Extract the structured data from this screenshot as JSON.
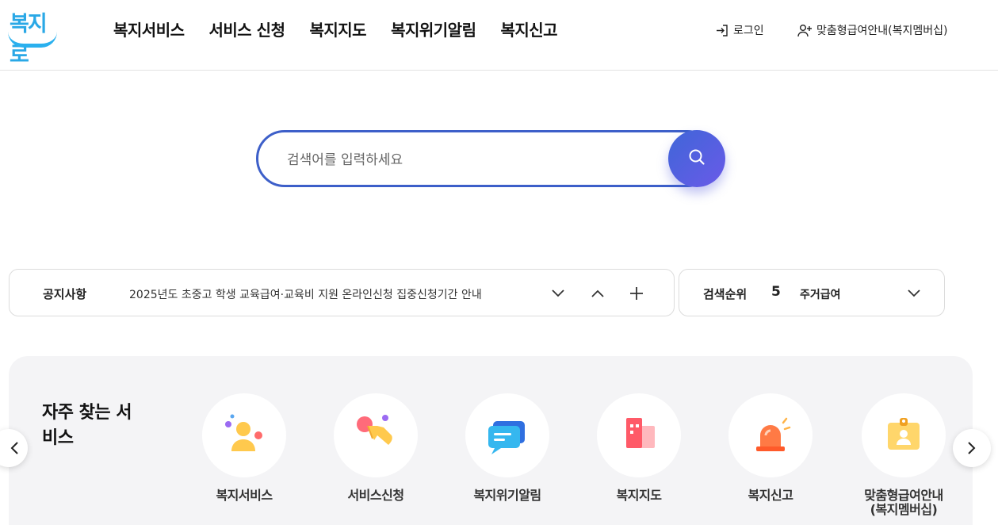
{
  "header": {
    "logo_text": "복지로",
    "nav": [
      "복지서비스",
      "서비스 신청",
      "복지지도",
      "복지위기알림",
      "복지신고"
    ],
    "login_label": "로그인",
    "membership_label": "맞춤형급여안내(복지멤버십)"
  },
  "search": {
    "placeholder": "검색어를 입력하세요"
  },
  "notice": {
    "label": "공지사항",
    "text": "2025년도 초중고 학생 교육급여·교육비 지원 온라인신청 집중신청기간 안내"
  },
  "ranking": {
    "label": "검색순위",
    "number": "5",
    "term": "주거급여"
  },
  "frequent": {
    "title": "자주 찾는 서비스",
    "items": [
      {
        "label": "복지서비스",
        "icon": "people-icon"
      },
      {
        "label": "서비스신청",
        "icon": "touch-hand-icon"
      },
      {
        "label": "복지위기알림",
        "icon": "chat-bubble-icon"
      },
      {
        "label": "복지지도",
        "icon": "building-map-icon"
      },
      {
        "label": "복지신고",
        "icon": "siren-icon"
      },
      {
        "label": "맞춤형급여안내\n(복지멤버십)",
        "icon": "id-card-icon"
      }
    ]
  },
  "colors": {
    "accent_blue": "#3d5fc9",
    "search_button_start": "#3f66d8",
    "search_button_end": "#6a5ae8",
    "logo_blue": "#2aa8e6",
    "panel_bg": "#f4f4f6"
  }
}
